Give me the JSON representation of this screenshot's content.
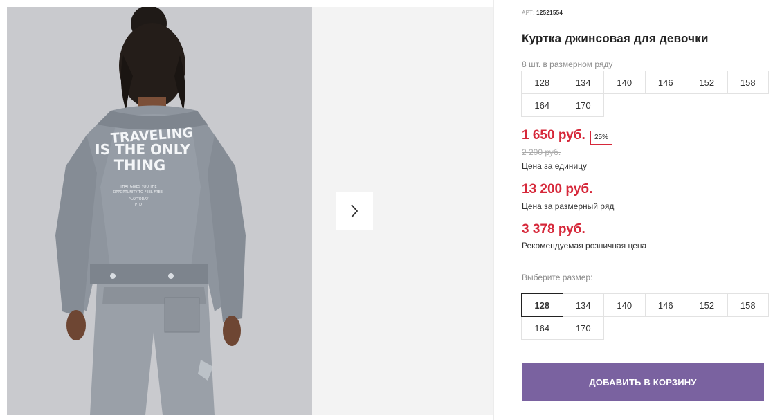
{
  "product": {
    "sku_label": "АРТ:",
    "sku_value": "12521554",
    "title": "Куртка джинсовая для девочки",
    "pack_caption": "8 шт. в размерном ряду",
    "pack_sizes": [
      "128",
      "134",
      "140",
      "146",
      "152",
      "158",
      "164",
      "170"
    ],
    "unit_price": "1 650 руб.",
    "discount_badge": "25%",
    "old_price": "2 200 руб.",
    "unit_price_label": "Цена за единицу",
    "pack_price": "13 200 руб.",
    "pack_price_label": "Цена за размерный ряд",
    "retail_price": "3 378 руб.",
    "retail_price_label": "Рекомендуемая розничная цена",
    "choose_size_caption": "Выберите размер:",
    "sizes": [
      "128",
      "134",
      "140",
      "146",
      "152",
      "158",
      "164",
      "170"
    ],
    "selected_size": "128",
    "add_to_cart_label": "ДОБАВИТЬ В КОРЗИНУ"
  },
  "photo": {
    "print_line1": "TRAVELING",
    "print_line2": "IS THE ONLY",
    "print_line3": "THING",
    "small_line1": "THAT GIVES YOU THE",
    "small_line2": "OPPORTUNITY TO FEEL FREE.",
    "small_line3": "PLAYTODAY",
    "small_line4": "PTD"
  },
  "icons": {
    "next": "chevron-right-icon"
  },
  "colors": {
    "accent": "#7a62a0",
    "price": "#d6283a",
    "photo_bg": "#c9cace"
  }
}
